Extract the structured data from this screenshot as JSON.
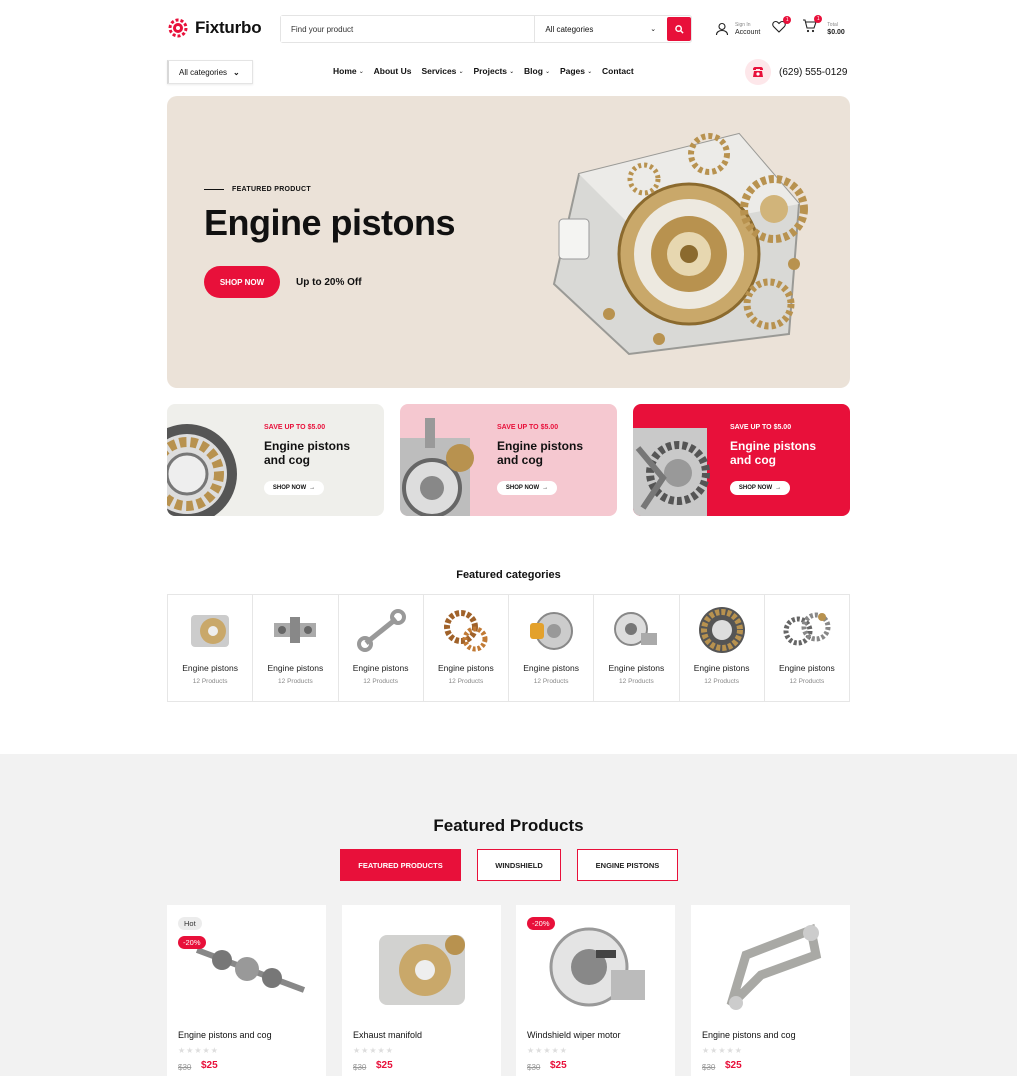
{
  "brand": {
    "name": "Fixturbo",
    "accent": "#e8103a"
  },
  "search": {
    "placeholder": "Find your product",
    "category": "All categories"
  },
  "header": {
    "sign_in": "Sign In",
    "account": "Account",
    "wishlist_count": "1",
    "cart_count": "1",
    "total_label": "Total",
    "total_value": "$0.00"
  },
  "nav": {
    "all_categories": "All categories",
    "items": [
      "Home",
      "About Us",
      "Services",
      "Projects",
      "Blog",
      "Pages",
      "Contact"
    ],
    "phone": "(629) 555-0129"
  },
  "hero": {
    "eyebrow": "FEATURED PRODUCT",
    "title": "Engine pistons",
    "button": "SHOP NOW",
    "offer": "Up to 20% Off"
  },
  "promos": [
    {
      "save": "SAVE UP TO $5.00",
      "title": "Engine pistons and cog",
      "button": "SHOP NOW"
    },
    {
      "save": "SAVE UP TO $5.00",
      "title": "Engine pistons and cog",
      "button": "SHOP NOW"
    },
    {
      "save": "SAVE UP TO $5.00",
      "title": "Engine pistons and cog",
      "button": "SHOP NOW"
    }
  ],
  "featured_categories": {
    "title": "Featured categories",
    "items": [
      {
        "name": "Engine pistons",
        "count": "12 Products"
      },
      {
        "name": "Engine pistons",
        "count": "12 Products"
      },
      {
        "name": "Engine pistons",
        "count": "12 Products"
      },
      {
        "name": "Engine pistons",
        "count": "12 Products"
      },
      {
        "name": "Engine pistons",
        "count": "12 Products"
      },
      {
        "name": "Engine pistons",
        "count": "12 Products"
      },
      {
        "name": "Engine pistons",
        "count": "12 Products"
      },
      {
        "name": "Engine pistons",
        "count": "12 Products"
      }
    ]
  },
  "featured_products": {
    "title": "Featured Products",
    "tabs": [
      "FEATURED PRODUCTS",
      "WINDSHIELD",
      "ENGINE PISTONS"
    ],
    "items": [
      {
        "name": "Engine pistons and cog",
        "old_price": "$30",
        "price": "$25",
        "tag": "Hot",
        "discount": "-20%"
      },
      {
        "name": "Exhaust manifold",
        "old_price": "$30",
        "price": "$25"
      },
      {
        "name": "Windshield wiper motor",
        "old_price": "$30",
        "price": "$25",
        "discount": "-20%"
      },
      {
        "name": "Engine pistons and cog",
        "old_price": "$30",
        "price": "$25"
      }
    ]
  }
}
